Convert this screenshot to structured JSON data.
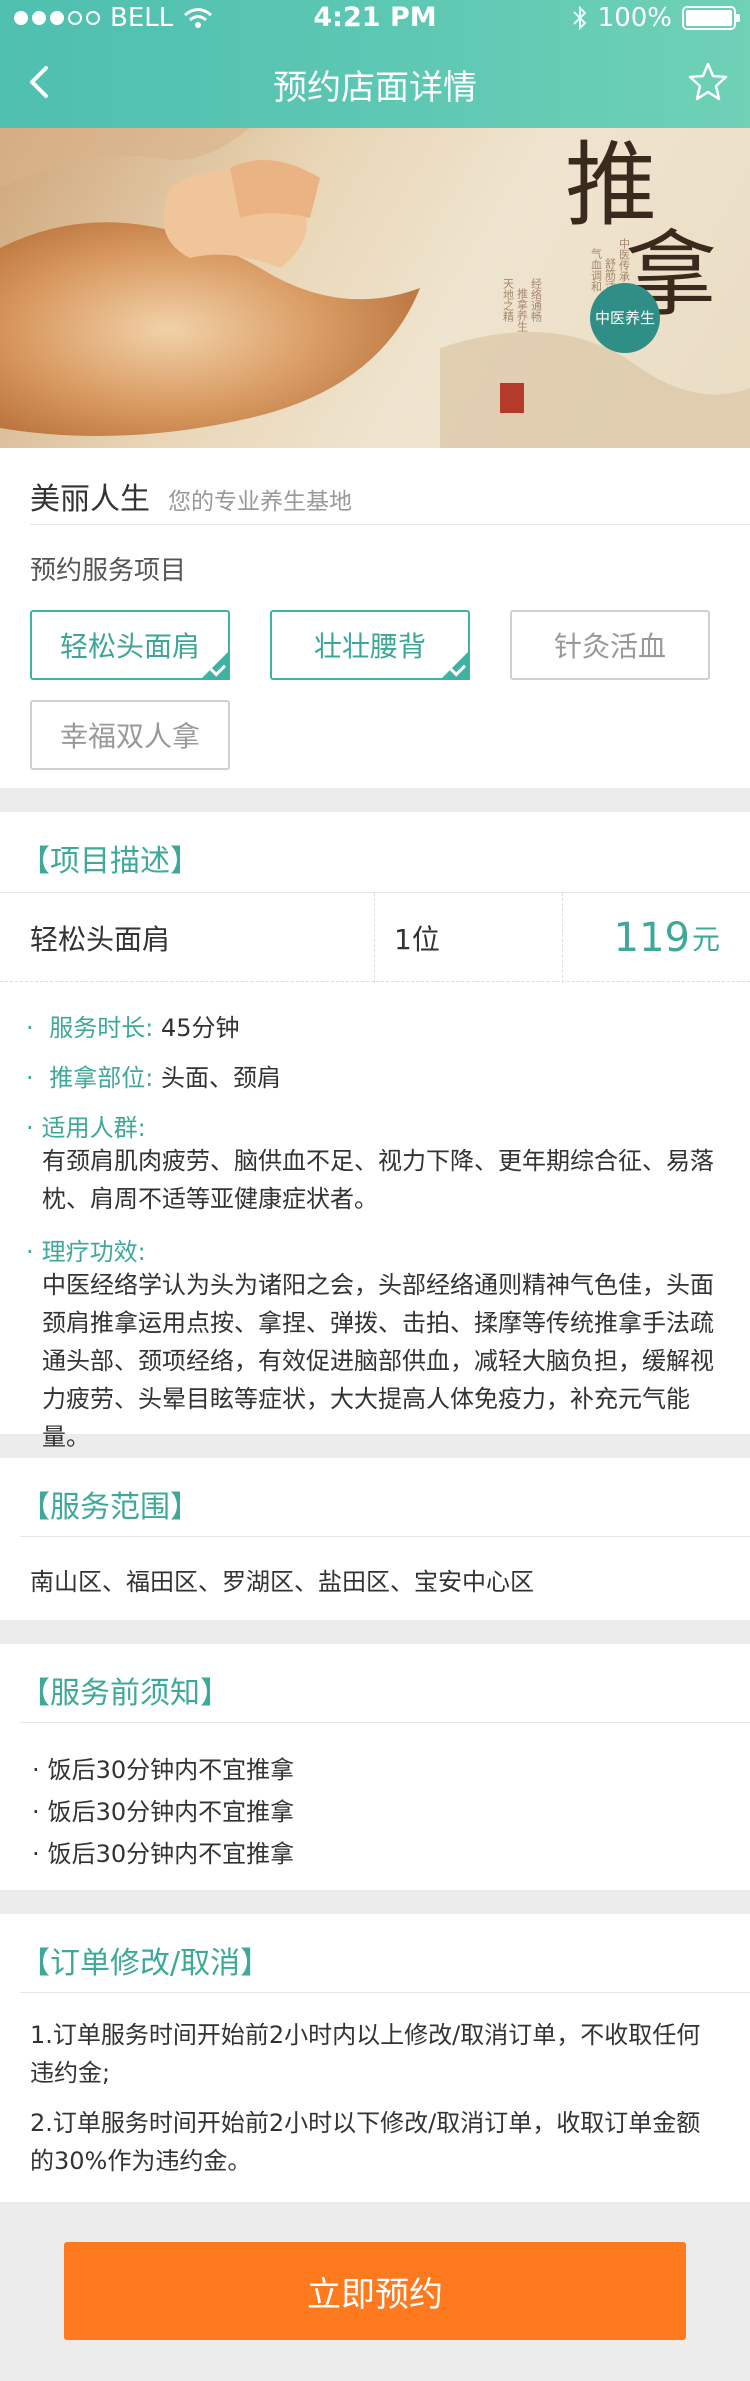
{
  "status_bar": {
    "carrier": "BELL",
    "time": "4:21 PM",
    "battery": "100%"
  },
  "nav": {
    "title": "预约店面详情"
  },
  "banner": {
    "title_char_1": "推",
    "title_char_2": "拿",
    "subtitle": "中医养生"
  },
  "shop": {
    "name": "美丽人生",
    "slogan": "您的专业养生基地"
  },
  "services": {
    "label": "预约服务项目",
    "items": [
      {
        "label": "轻松头面肩",
        "selected": true
      },
      {
        "label": "壮壮腰背",
        "selected": true
      },
      {
        "label": "针灸活血",
        "selected": false
      },
      {
        "label": "幸福双人拿",
        "selected": false
      }
    ]
  },
  "description": {
    "title": "【项目描述】",
    "item_name": "轻松头面肩",
    "people": "1位",
    "price": "119",
    "price_unit": "元",
    "duration_label": "服务时长:",
    "duration_value": "45分钟",
    "area_label": "推拿部位:",
    "area_value": "头面、颈肩",
    "target_label": "适用人群:",
    "target_text": "有颈肩肌肉疲劳、脑供血不足、视力下降、更年期综合征、易落枕、肩周不适等亚健康症状者。",
    "effect_label": "理疗功效:",
    "effect_text": "中医经络学认为头为诸阳之会，头部经络通则精神气色佳，头面颈肩推拿运用点按、拿捏、弹拨、击拍、揉摩等传统推拿手法疏通头部、颈项经络，有效促进脑部供血，减轻大脑负担，缓解视力疲劳、头晕目眩等症状，大大提高人体免疫力，补充元气能量。"
  },
  "service_range": {
    "title": "【服务范围】",
    "text": "南山区、福田区、罗湖区、盐田区、宝安中心区"
  },
  "notice": {
    "title": "【服务前须知】",
    "items": [
      "饭后30分钟内不宜推拿",
      "饭后30分钟内不宜推拿",
      "饭后30分钟内不宜推拿"
    ]
  },
  "cancel_policy": {
    "title": "【订单修改/取消】",
    "rule_1": "1.订单服务时间开始前2小时内以上修改/取消订单，不收取任何违约金;",
    "rule_2": "2.订单服务时间开始前2小时以下修改/取消订单，收取订单金额的30%作为违约金。"
  },
  "book_button": "立即预约",
  "colors": {
    "header": "#5cc7b3",
    "accent": "#3ea899",
    "button": "#ff7a1f"
  }
}
